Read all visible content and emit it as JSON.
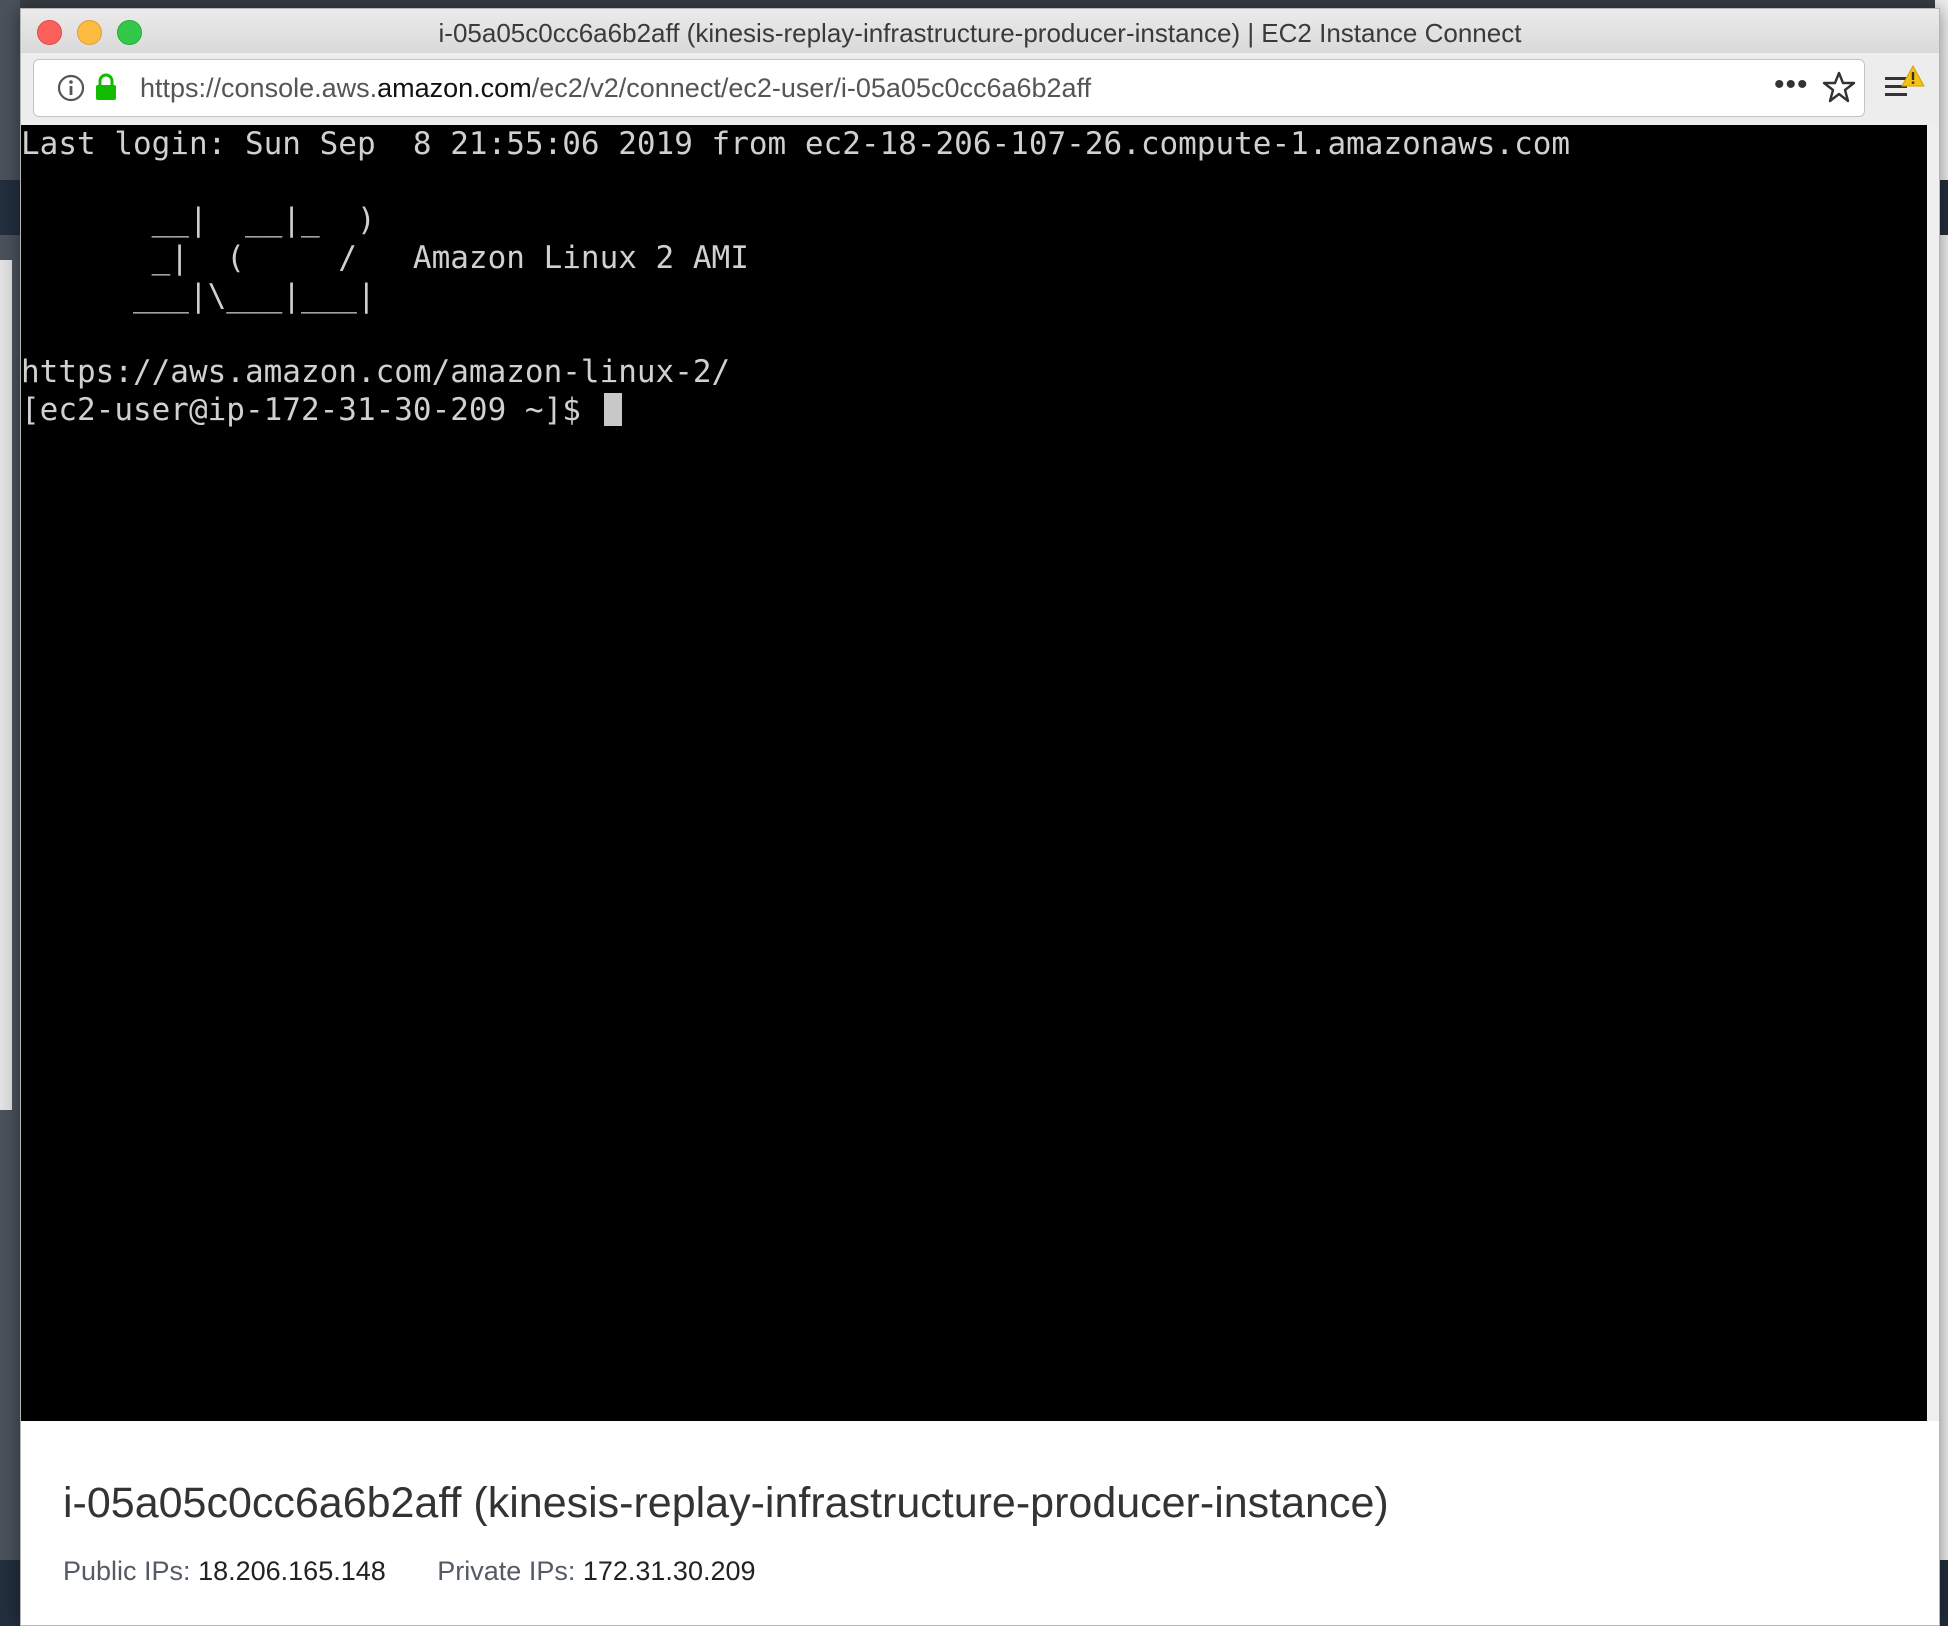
{
  "window": {
    "title": "i-05a05c0cc6a6b2aff (kinesis-replay-infrastructure-producer-instance) | EC2 Instance Connect"
  },
  "toolbar": {
    "url_prefix": "https://console.aws.",
    "url_host": "amazon.com",
    "url_path": "/ec2/v2/connect/ec2-user/i-05a05c0cc6a6b2aff",
    "more_label": "•••"
  },
  "terminal": {
    "lines": [
      "Last login: Sun Sep  8 21:55:06 2019 from ec2-18-206-107-26.compute-1.amazonaws.com",
      "",
      "       __|  __|_  )",
      "       _|  (     /   Amazon Linux 2 AMI",
      "      ___|\\___|___|",
      "",
      "https://aws.amazon.com/amazon-linux-2/"
    ],
    "prompt": "[ec2-user@ip-172-31-30-209 ~]$ "
  },
  "instance": {
    "title": "i-05a05c0cc6a6b2aff (kinesis-replay-infrastructure-producer-instance)",
    "public_ips_label": "Public IPs:",
    "public_ips_value": "18.206.165.148",
    "private_ips_label": "Private IPs:",
    "private_ips_value": "172.31.30.209"
  }
}
